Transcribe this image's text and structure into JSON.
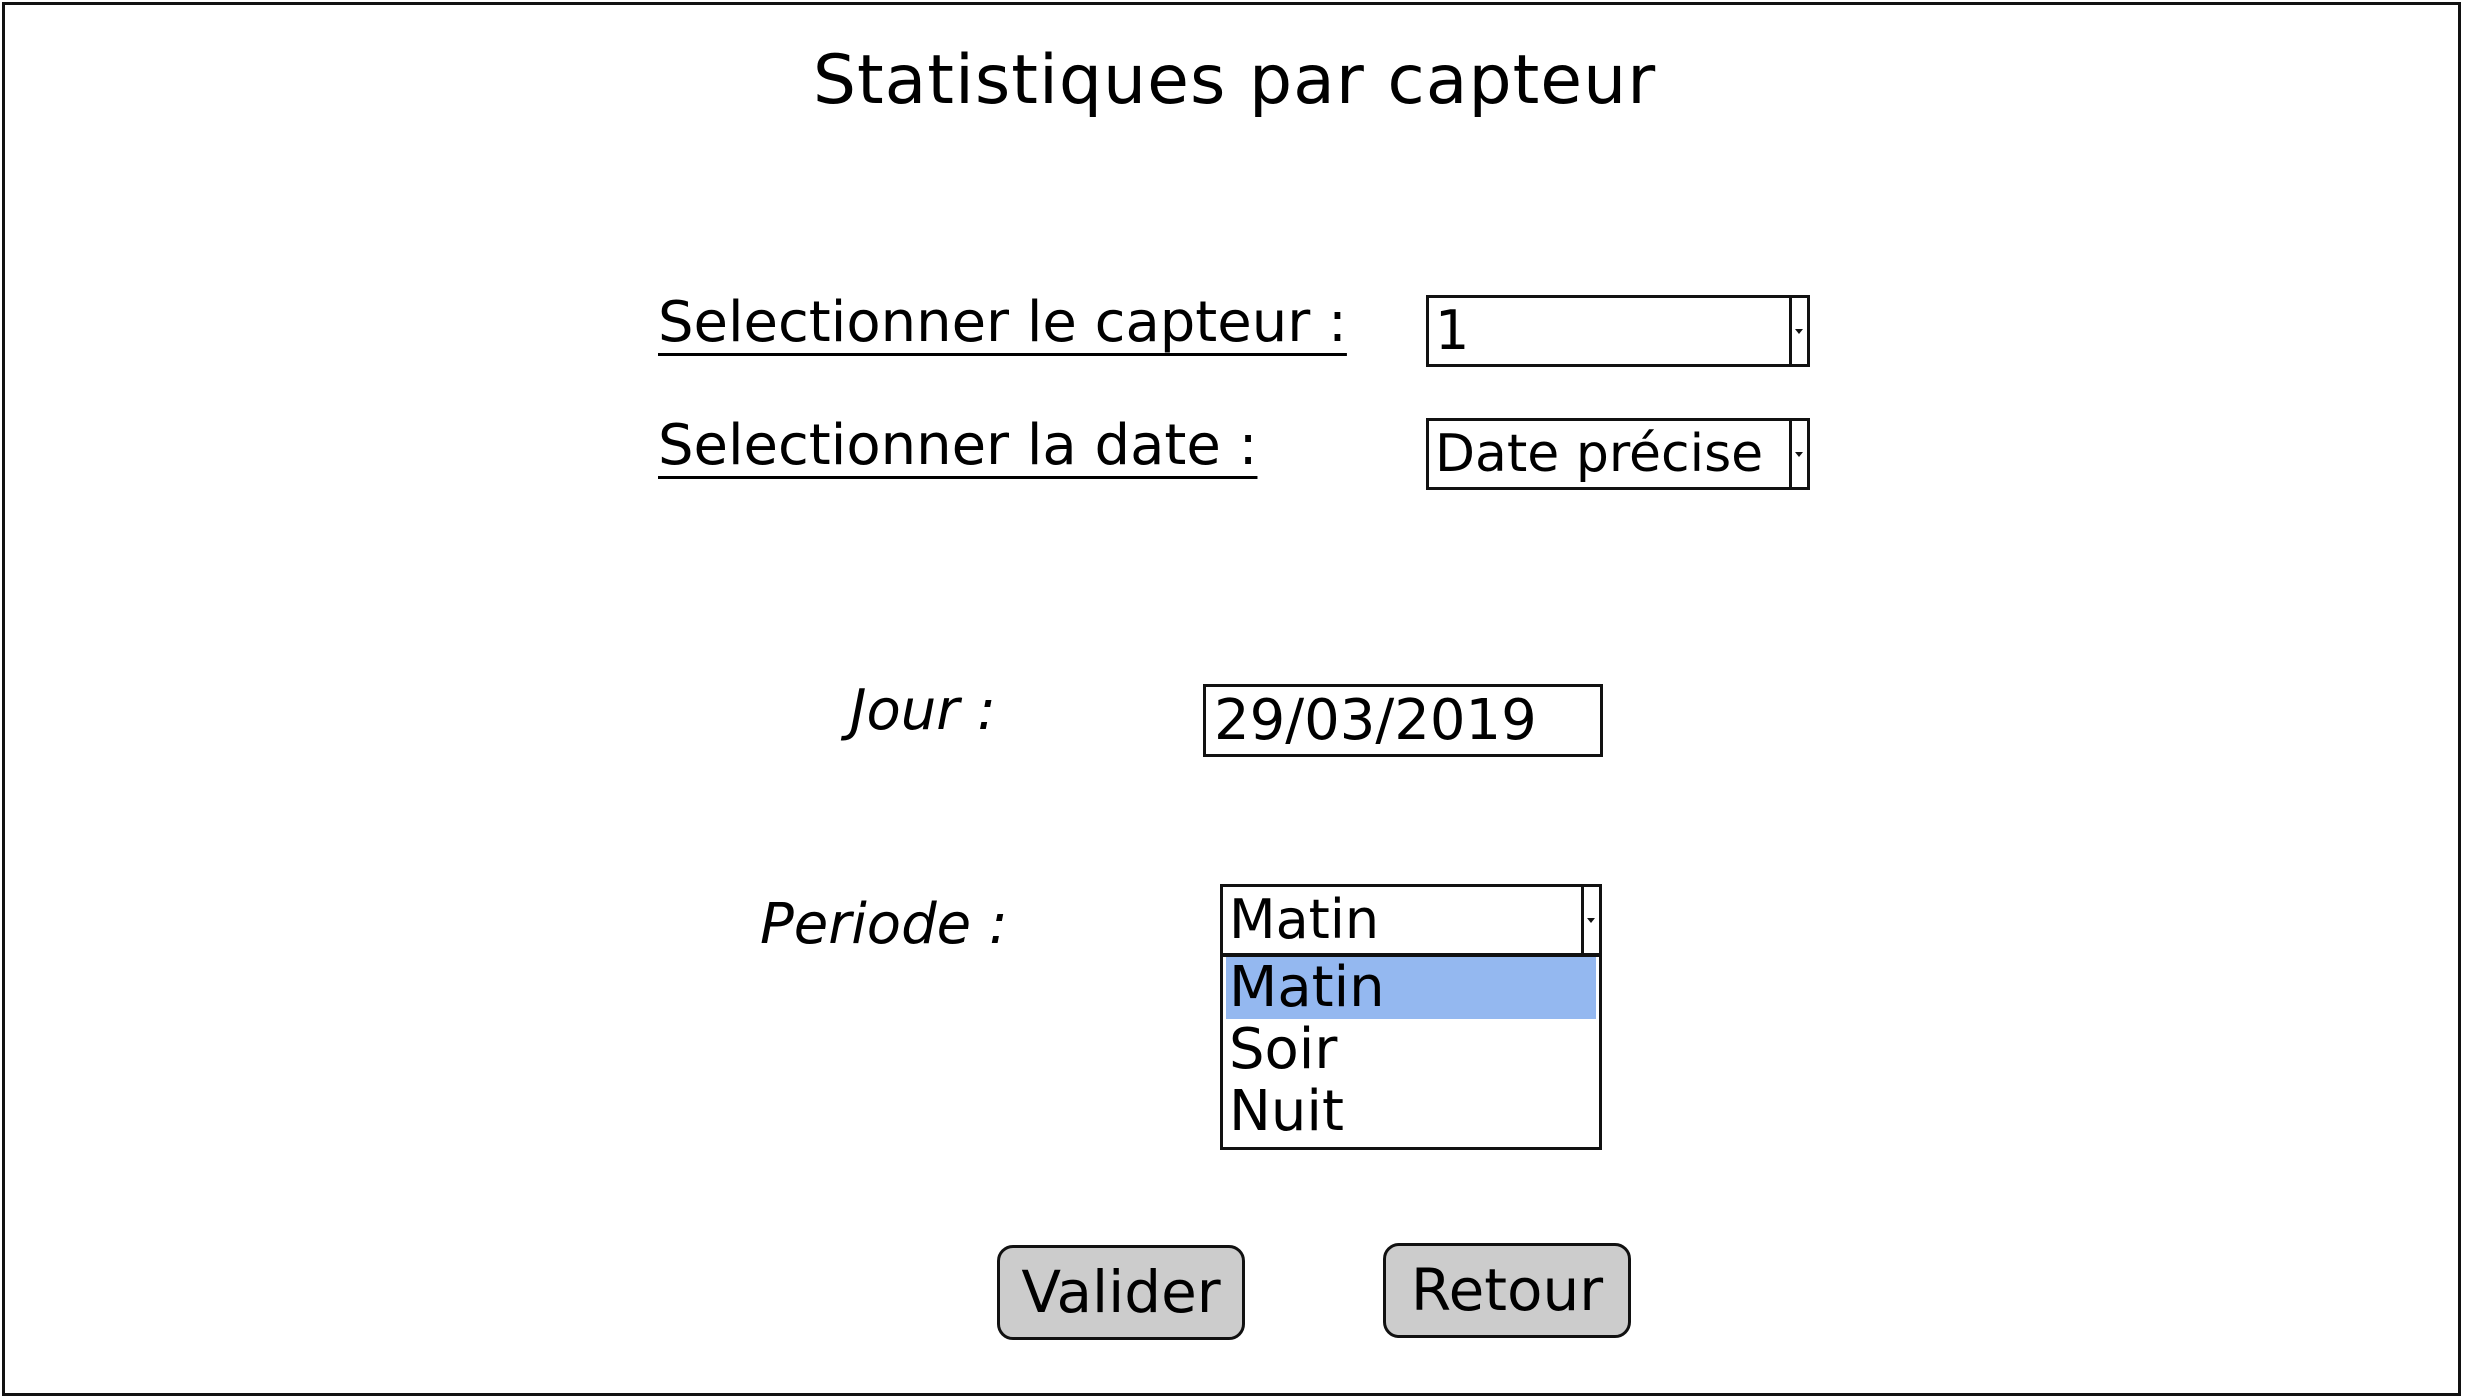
{
  "page": {
    "title": "Statistiques par capteur"
  },
  "form": {
    "sensor_label": "Selectionner le capteur :",
    "sensor_value": "1",
    "date_label": "Selectionner la date :",
    "date_mode_value": "Date précise",
    "day_label": "Jour :",
    "day_value": "29/03/2019",
    "period_label": "Periode :",
    "period_value": "Matin",
    "period_options": [
      "Matin",
      "Soir",
      "Nuit"
    ],
    "period_selected_index": 0
  },
  "buttons": {
    "validate_label": "Valider",
    "back_label": "Retour"
  },
  "colors": {
    "selected_option_bg": "#94b8f0",
    "button_bg": "#cccccc"
  }
}
